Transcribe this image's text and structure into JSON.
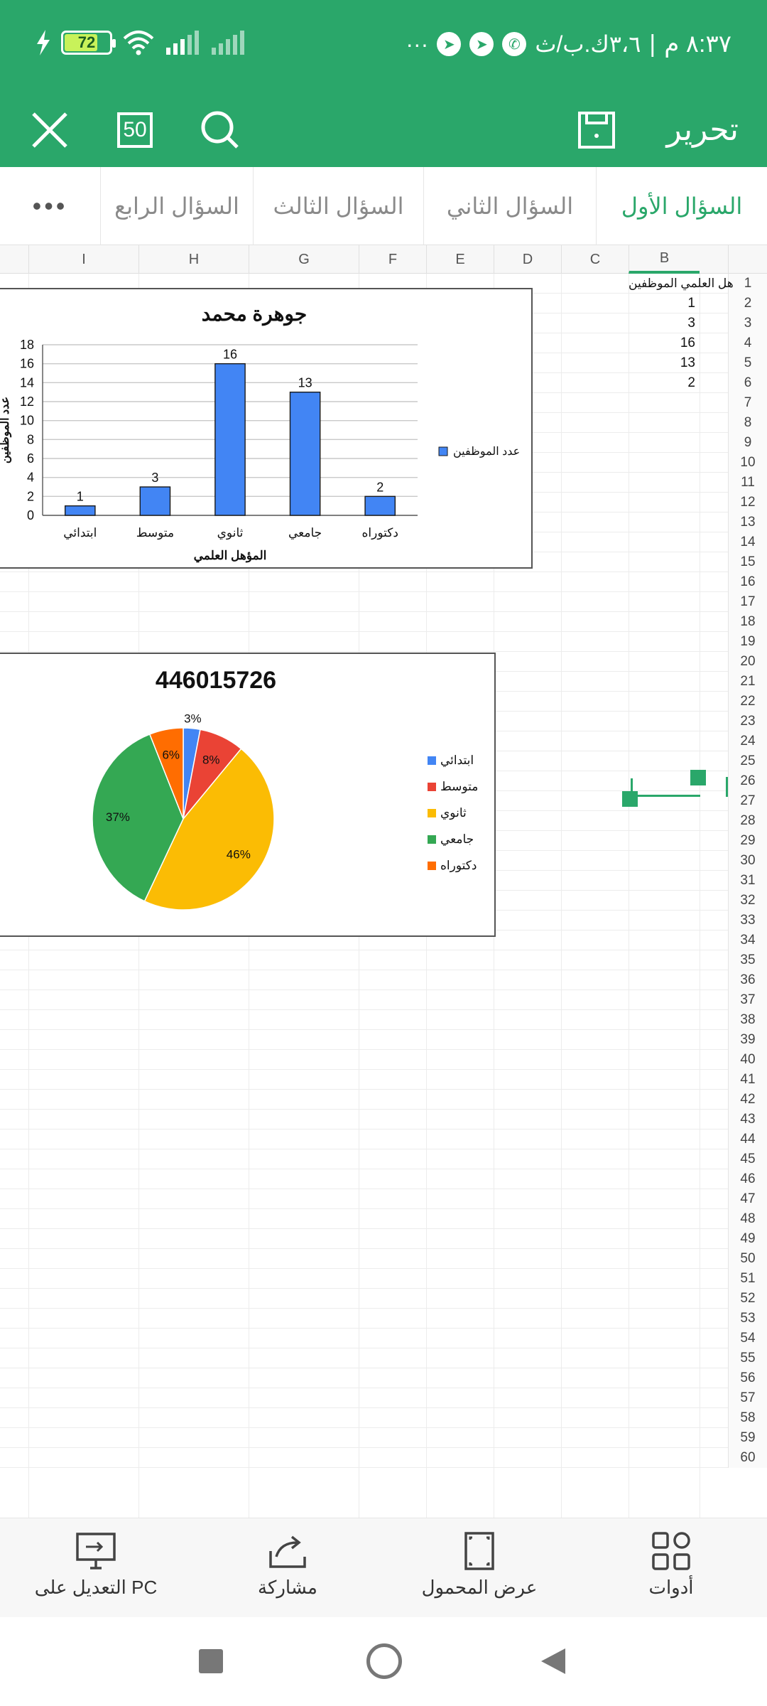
{
  "status_bar": {
    "time": "٨:٣٧ م",
    "carrier": "٣،٦ك.ب/ث",
    "battery": "72"
  },
  "toolbar": {
    "title": "تحرير",
    "zoom_badge": "50"
  },
  "tabs": [
    {
      "label": "السؤال الأول",
      "active": true
    },
    {
      "label": "السؤال الثاني",
      "active": false
    },
    {
      "label": "السؤال الثالث",
      "active": false
    },
    {
      "label": "السؤال الرابع",
      "active": false
    }
  ],
  "columns": [
    "I",
    "H",
    "G",
    "F",
    "E",
    "D",
    "C",
    "B"
  ],
  "column_b": {
    "header_cell": "هل العلمي الموظفين",
    "values": [
      "1",
      "3",
      "16",
      "13",
      "2"
    ]
  },
  "row_count": 60,
  "colors": {
    "accent": "#2aa76a",
    "bar": "#4285f4"
  },
  "chart_data": [
    {
      "type": "bar",
      "title": "جوهرة محمد",
      "categories": [
        "ابتدائي",
        "متوسط",
        "ثانوي",
        "جامعي",
        "دكتوراه"
      ],
      "series": [
        {
          "name": "عدد الموظفين",
          "values": [
            1,
            3,
            16,
            13,
            2
          ]
        }
      ],
      "xlabel": "المؤهل العلمي",
      "ylabel": "عدد الموظفين",
      "ylim": [
        0,
        18
      ],
      "yticks": [
        0,
        2,
        4,
        6,
        8,
        10,
        12,
        14,
        16,
        18
      ],
      "grid": true,
      "legend": "right"
    },
    {
      "type": "pie",
      "title": "446015726",
      "categories": [
        "ابتدائي",
        "متوسط",
        "ثانوي",
        "جامعي",
        "دكتوراه"
      ],
      "values": [
        3,
        8,
        46,
        37,
        6
      ],
      "labels": [
        "3%",
        "8%",
        "46%",
        "37%",
        "6%"
      ],
      "colors": [
        "#4285f4",
        "#ea4335",
        "#fbbc04",
        "#34a853",
        "#ff6d01"
      ],
      "legend": "right"
    }
  ],
  "bottom_bar": [
    {
      "label": "أدوات",
      "icon": "grid-icon"
    },
    {
      "label": "عرض المحمول",
      "icon": "fullscreen-icon"
    },
    {
      "label": "مشاركة",
      "icon": "share-icon"
    },
    {
      "label": "التعديل على PC",
      "icon": "monitor-icon"
    }
  ]
}
